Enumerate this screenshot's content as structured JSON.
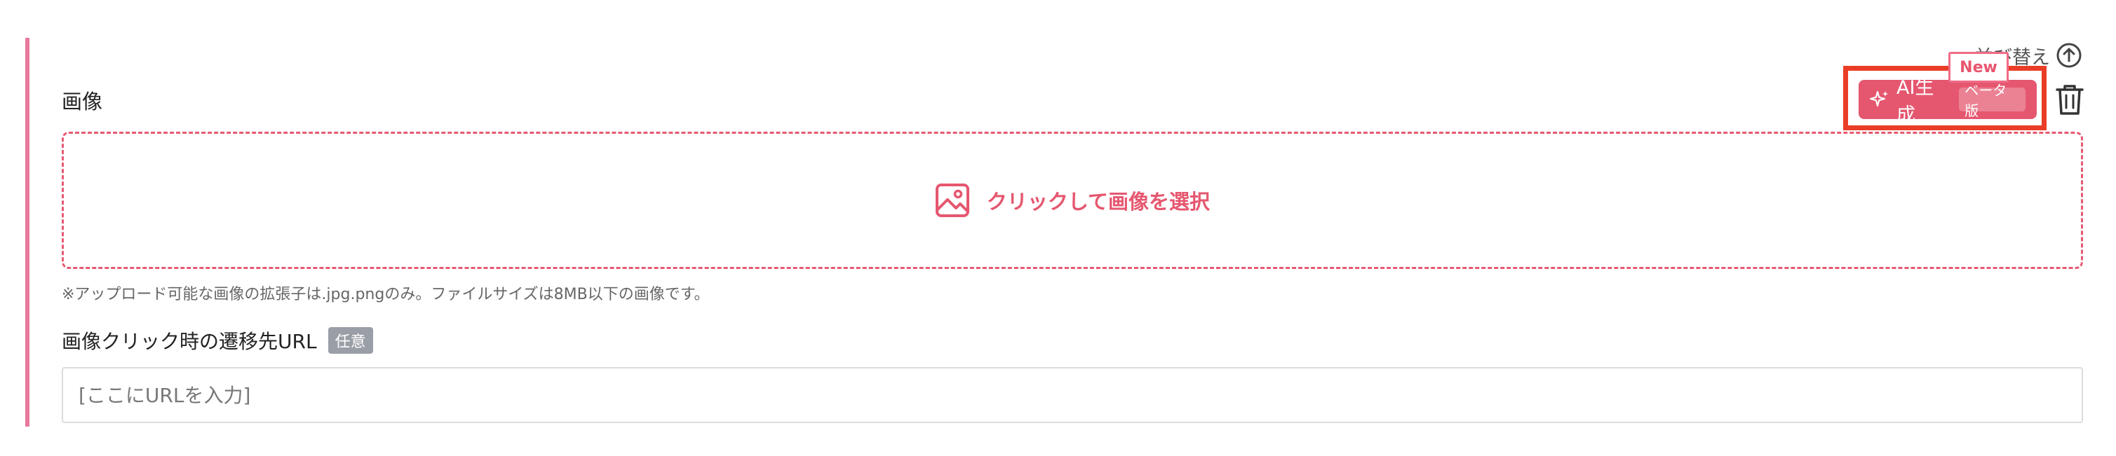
{
  "header": {
    "sort_label": "並び替え",
    "sort_icon": "arrow-up-circle-icon"
  },
  "image_section": {
    "label": "画像",
    "ai_button": {
      "label": "AI生成",
      "beta_label": "ベータ版",
      "new_tag": "New",
      "icon": "sparkle-icon"
    },
    "delete_icon": "trash-icon",
    "dropzone": {
      "icon": "image-icon",
      "label": "クリックして画像を選択"
    },
    "note": "※アップロード可能な画像の拡張子は.jpg.pngのみ。ファイルサイズは8MB以下の画像です。"
  },
  "url_section": {
    "label": "画像クリック時の遷移先URL",
    "badge": "任意",
    "input_placeholder": "[ここにURLを入力]",
    "input_value": ""
  },
  "colors": {
    "accent": "#e5576f",
    "highlight": "#ea3d26",
    "left_bar": "#e8799b"
  }
}
